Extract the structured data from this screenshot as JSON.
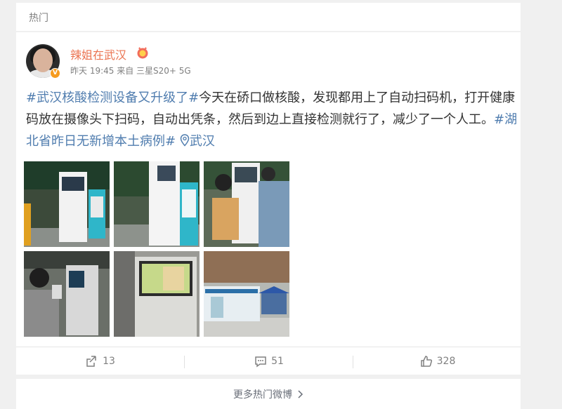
{
  "header": {
    "title": "热门"
  },
  "post": {
    "username": "辣姐在武汉",
    "meta": "昨天 19:45 来自 三星S20+ 5G",
    "text": {
      "hashtag1": "#武汉核酸检测设备又升级了#",
      "body": "今天在硚口做核酸，发现都用上了自动扫码机，打开健康码放在摄像头下扫码，自动出凭条，然后到边上直接检测就行了，减少了一个人工。",
      "hashtag2": "#湖北省昨日无新增本土病例#",
      "location": "武汉"
    },
    "images": [
      {
        "name": "kiosk-photo-1"
      },
      {
        "name": "kiosk-photo-2"
      },
      {
        "name": "kiosk-photo-3"
      },
      {
        "name": "kiosk-photo-4"
      },
      {
        "name": "kiosk-photo-5"
      },
      {
        "name": "kiosk-photo-6"
      }
    ],
    "actions": {
      "share_count": "13",
      "comment_count": "51",
      "like_count": "328"
    }
  },
  "footer": {
    "more_label": "更多热门微博"
  },
  "colors": {
    "accent": "#eb7350",
    "link": "#507daf",
    "muted": "#808080"
  }
}
